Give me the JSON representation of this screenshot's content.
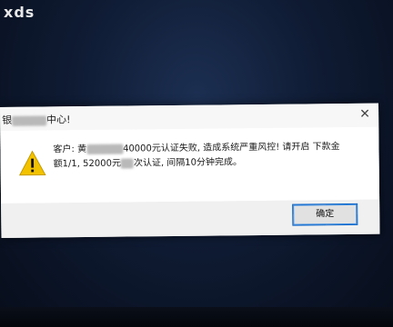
{
  "watermark": "xds",
  "dialog": {
    "title_prefix": "银",
    "title_suffix": "中心!",
    "message_line1_a": "客户: 黄",
    "message_line1_b": "40000元认证失败, 造成系统严重风控! 请开启 下款金",
    "message_line2_a": "额1/1, 52000元",
    "message_line2_b": "次认证, 间隔10分钟完成。",
    "ok_label": "确定",
    "close_glyph": "✕"
  },
  "colors": {
    "warning": "#f2c200",
    "accent": "#0a64c8"
  },
  "icons": [
    "warning-icon",
    "close-icon"
  ]
}
